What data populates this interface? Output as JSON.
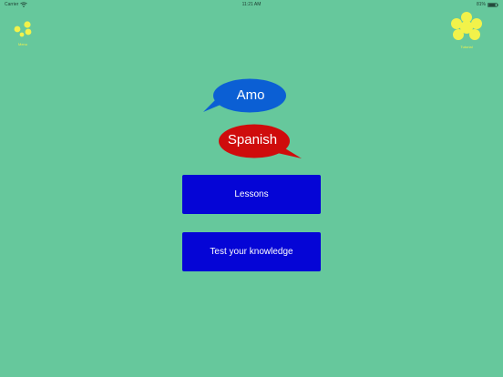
{
  "colors": {
    "background": "#66c89c",
    "bubble_blue": "#0b5fd4",
    "bubble_red": "#cf0c0c",
    "button_blue": "#0505d6",
    "flower_yellow": "#f2f24a"
  },
  "status_bar": {
    "carrier": "Carrier",
    "time": "11:21 AM",
    "battery_percent": "81%"
  },
  "corner_buttons": {
    "menu_label": "Menu",
    "tutorial_label": "Tutorial"
  },
  "bubbles": {
    "word": "Amo",
    "language": "Spanish"
  },
  "buttons": {
    "lessons": "Lessons",
    "test": "Test your knowledge"
  }
}
